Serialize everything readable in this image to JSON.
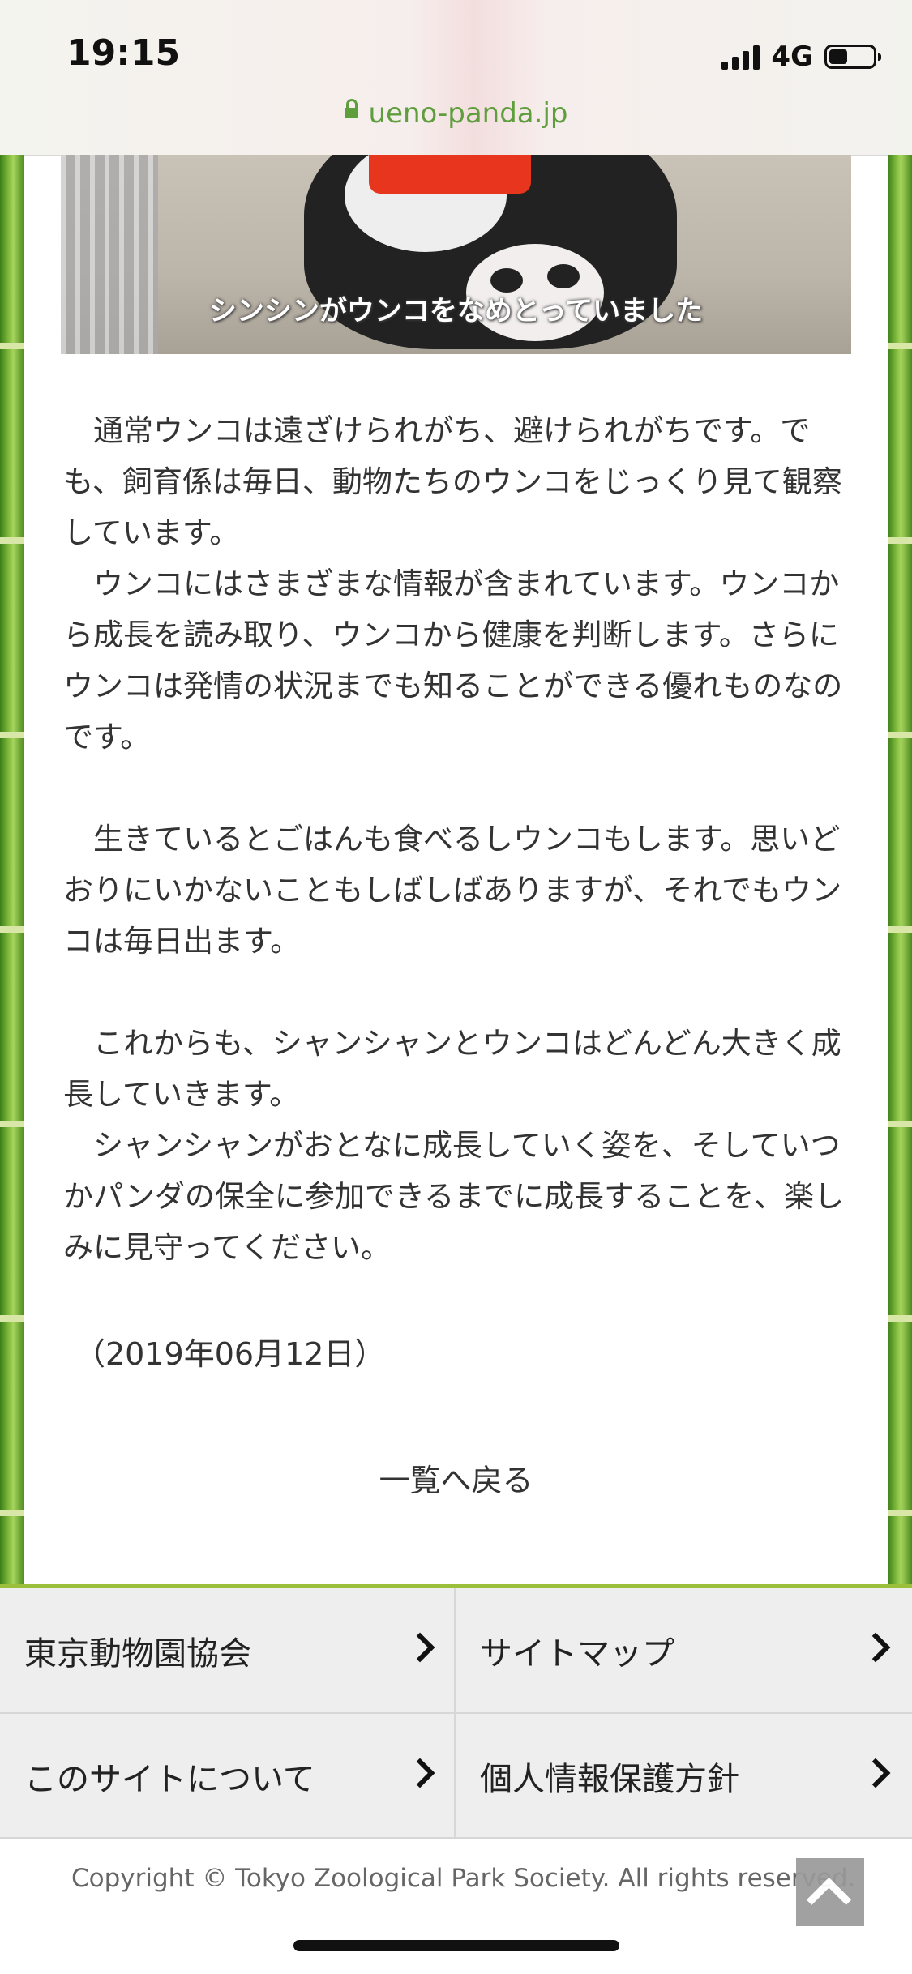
{
  "status_bar": {
    "time": "19:15",
    "network": "4G",
    "battery_icon": "battery-icon",
    "signal_icon": "signal-icon"
  },
  "browser": {
    "url": "ueno-panda.jp",
    "lock_icon": "lock-icon"
  },
  "photo": {
    "caption": "シンシンがウンコをなめとっていました"
  },
  "article": {
    "paragraphs": [
      "通常ウンコは遠ざけられがち、避けられがちです。でも、飼育係は毎日、動物たちのウンコをじっくり見て観察しています。",
      "ウンコにはさまざまな情報が含まれています。ウンコから成長を読み取り、ウンコから健康を判断します。さらにウンコは発情の状況までも知ることができる優れものなのです。",
      "生きているとごはんも食べるしウンコもします。思いどおりにいかないこともしばしばありますが、それでもウンコは毎日出ます。",
      "これからも、シャンシャンとウンコはどんどん大きく成長していきます。",
      "シャンシャンがおとなに成長していく姿を、そしていつかパンダの保全に参加できるまでに成長することを、楽しみに見守ってください。"
    ],
    "date": "（2019年06月12日）",
    "back_link": "一覧へ戻る"
  },
  "footer": {
    "nav": [
      {
        "label": "東京動物園協会"
      },
      {
        "label": "サイトマップ"
      },
      {
        "label": "このサイトについて"
      },
      {
        "label": "個人情報保護方針"
      }
    ],
    "copyright": "Copyright © Tokyo Zoological Park Society. All rights reserved.",
    "totop_icon": "chevron-up-icon"
  },
  "colors": {
    "accent_green": "#9bbf3b",
    "url_green": "#5f9e3d",
    "nav_bg": "#eeeeee"
  }
}
